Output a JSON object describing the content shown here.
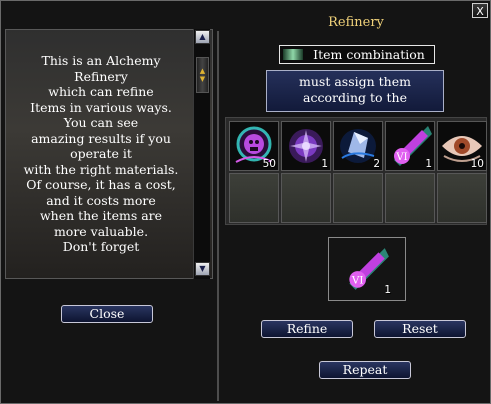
{
  "window": {
    "title": "Refinery",
    "close_glyph": "X"
  },
  "description": {
    "lines": [
      "This is an Alchemy",
      "Refinery",
      "which can refine",
      "Items in various ways.",
      "You can see",
      "amazing results if you",
      "operate it",
      "with the right materials.",
      "Of course, it has a cost,",
      "and it costs more",
      "when the items are",
      "more valuable.",
      "Don't forget"
    ],
    "close_button": "Close"
  },
  "mode": {
    "label": "Item combination"
  },
  "info": {
    "lines": [
      "must assign them",
      "according to the"
    ]
  },
  "materials": [
    {
      "icon": "skull-orb-icon",
      "quantity": "50"
    },
    {
      "icon": "purple-crystal-orb-icon",
      "quantity": "1"
    },
    {
      "icon": "blue-gem-icon",
      "quantity": "2"
    },
    {
      "icon": "violet-rune-shard-icon",
      "quantity": "1"
    },
    {
      "icon": "eye-scroll-icon",
      "quantity": "10"
    }
  ],
  "result": {
    "icon": "violet-rune-shard-icon",
    "quantity": "1"
  },
  "buttons": {
    "refine": "Refine",
    "reset": "Reset",
    "repeat": "Repeat"
  },
  "colors": {
    "title": "#f0d27a",
    "button_bg": "#1a2448",
    "panel_bg": "#141414"
  }
}
